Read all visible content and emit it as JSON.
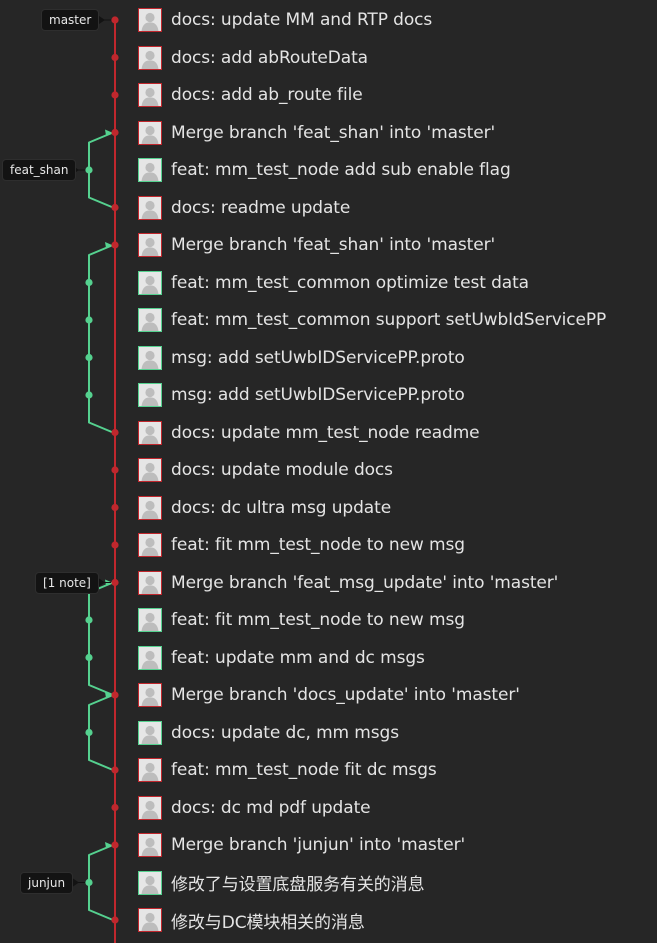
{
  "colors": {
    "background": "#262626",
    "main_line": "#c0272d",
    "side_line": "#55d18f",
    "avatar_border_main": "#c0272d",
    "avatar_border_side": "#55d18f",
    "text": "#e4e4e4",
    "tag_background": "#131313"
  },
  "tags": [
    {
      "label": "master"
    },
    {
      "label": "feat_shan"
    },
    {
      "label": "[1 note]"
    },
    {
      "label": "junjun"
    }
  ],
  "commits": [
    {
      "message": "docs: update MM and RTP docs",
      "lane": "main",
      "avatar_icon": "user-avatar-icon"
    },
    {
      "message": "docs: add abRouteData",
      "lane": "main",
      "avatar_icon": "user-avatar-icon"
    },
    {
      "message": "docs: add ab_route file",
      "lane": "main",
      "avatar_icon": "user-avatar-icon"
    },
    {
      "message": "Merge branch 'feat_shan' into 'master'",
      "lane": "main",
      "avatar_icon": "user-avatar-icon"
    },
    {
      "message": "feat: mm_test_node add sub enable flag",
      "lane": "side",
      "avatar_icon": "user-avatar-icon"
    },
    {
      "message": "docs: readme update",
      "lane": "main",
      "avatar_icon": "user-avatar-icon"
    },
    {
      "message": "Merge branch 'feat_shan' into 'master'",
      "lane": "main",
      "avatar_icon": "user-avatar-icon"
    },
    {
      "message": "feat: mm_test_common optimize test data",
      "lane": "side",
      "avatar_icon": "user-avatar-icon"
    },
    {
      "message": "feat: mm_test_common support setUwbIdServicePP",
      "lane": "side",
      "avatar_icon": "user-avatar-icon"
    },
    {
      "message": "msg: add setUwbIDServicePP.proto",
      "lane": "side",
      "avatar_icon": "user-avatar-icon"
    },
    {
      "message": "msg: add setUwbIDServicePP.proto",
      "lane": "side",
      "avatar_icon": "user-avatar-icon"
    },
    {
      "message": "docs: update mm_test_node readme",
      "lane": "main",
      "avatar_icon": "user-avatar-icon"
    },
    {
      "message": "docs: update module docs",
      "lane": "main",
      "avatar_icon": "user-avatar-icon"
    },
    {
      "message": "docs: dc ultra msg update",
      "lane": "main",
      "avatar_icon": "user-avatar-icon"
    },
    {
      "message": "feat: fit mm_test_node to new msg",
      "lane": "main",
      "avatar_icon": "user-avatar-icon"
    },
    {
      "message": "Merge branch 'feat_msg_update' into 'master'",
      "lane": "main",
      "avatar_icon": "user-avatar-icon"
    },
    {
      "message": "feat: fit mm_test_node to new msg",
      "lane": "side",
      "avatar_icon": "user-avatar-icon"
    },
    {
      "message": "feat: update mm and dc msgs",
      "lane": "side",
      "avatar_icon": "user-avatar-icon"
    },
    {
      "message": "Merge branch 'docs_update' into 'master'",
      "lane": "main",
      "avatar_icon": "user-avatar-icon"
    },
    {
      "message": "docs: update dc, mm msgs",
      "lane": "side",
      "avatar_icon": "user-avatar-icon"
    },
    {
      "message": "feat: mm_test_node fit dc msgs",
      "lane": "main",
      "avatar_icon": "user-avatar-icon"
    },
    {
      "message": "docs: dc md pdf update",
      "lane": "main",
      "avatar_icon": "user-avatar-icon"
    },
    {
      "message": "Merge branch 'junjun' into 'master'",
      "lane": "main",
      "avatar_icon": "user-avatar-icon"
    },
    {
      "message": "修改了与设置底盘服务有关的消息",
      "lane": "side",
      "avatar_icon": "user-avatar-icon"
    },
    {
      "message": "修改与DC模块相关的消息",
      "lane": "main",
      "avatar_icon": "user-avatar-icon"
    }
  ]
}
